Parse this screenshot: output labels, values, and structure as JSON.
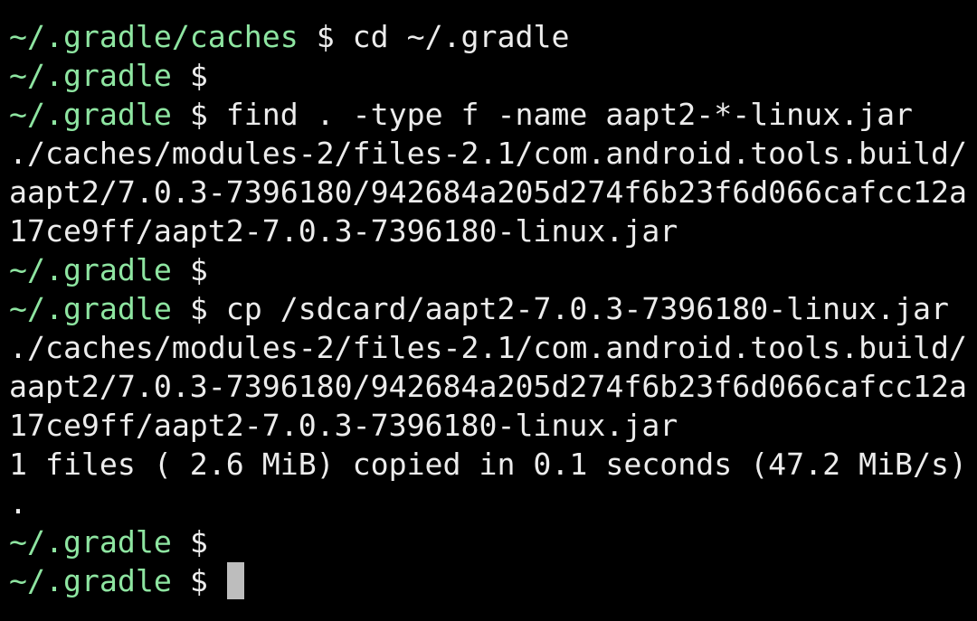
{
  "colors": {
    "background": "#000000",
    "prompt_path": "#8ee5a1",
    "text": "#ececec",
    "cursor": "#bdbdbd"
  },
  "terminal": {
    "lines": [
      {
        "kind": "prompt",
        "path": "~/.gradle/caches",
        "sign": "$",
        "command": "cd ~/.gradle"
      },
      {
        "kind": "prompt",
        "path": "~/.gradle",
        "sign": "$",
        "command": ""
      },
      {
        "kind": "prompt",
        "path": "~/.gradle",
        "sign": "$",
        "command": "find . -type f -name aapt2-*-linux.jar"
      },
      {
        "kind": "output",
        "text": "./caches/modules-2/files-2.1/com.android.tools.build/"
      },
      {
        "kind": "output",
        "text": "aapt2/7.0.3-7396180/942684a205d274f6b23f6d066cafcc12a"
      },
      {
        "kind": "output",
        "text": "17ce9ff/aapt2-7.0.3-7396180-linux.jar"
      },
      {
        "kind": "prompt",
        "path": "~/.gradle",
        "sign": "$",
        "command": ""
      },
      {
        "kind": "prompt",
        "path": "~/.gradle",
        "sign": "$",
        "command": "cp /sdcard/aapt2-7.0.3-7396180-linux.jar"
      },
      {
        "kind": "output",
        "text": "./caches/modules-2/files-2.1/com.android.tools.build/"
      },
      {
        "kind": "output",
        "text": "aapt2/7.0.3-7396180/942684a205d274f6b23f6d066cafcc12a"
      },
      {
        "kind": "output",
        "text": "17ce9ff/aapt2-7.0.3-7396180-linux.jar"
      },
      {
        "kind": "output",
        "text": "1 files ( 2.6 MiB) copied in 0.1 seconds (47.2 MiB/s)"
      },
      {
        "kind": "output",
        "text": "."
      },
      {
        "kind": "prompt",
        "path": "~/.gradle",
        "sign": "$",
        "command": ""
      },
      {
        "kind": "prompt",
        "path": "~/.gradle",
        "sign": "$",
        "command": "",
        "cursor": true
      }
    ]
  }
}
